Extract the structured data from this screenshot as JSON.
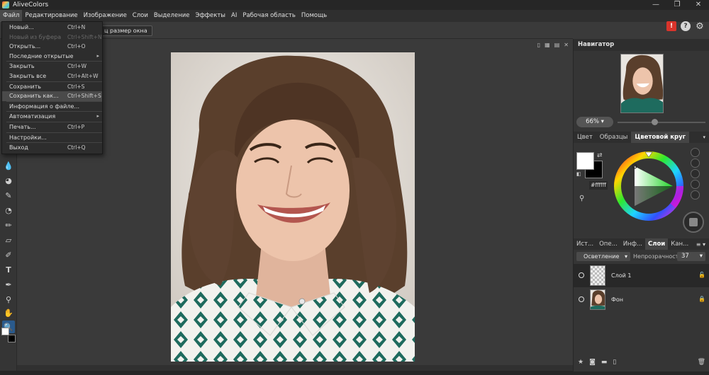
{
  "app": {
    "title": "AliveColors"
  },
  "window_controls": {
    "minimize": "—",
    "maximize": "❐",
    "close": "✕"
  },
  "menubar": [
    "Файл",
    "Редактирование",
    "Изображение",
    "Слои",
    "Выделение",
    "Эффекты",
    "AI",
    "Рабочая область",
    "Помощь"
  ],
  "options": {
    "fit_button": "ц размер окна"
  },
  "file_menu": [
    {
      "label": "Новый...",
      "shortcut": "Ctrl+N"
    },
    {
      "label": "Новый из буфера",
      "shortcut": "Ctrl+Shift+N",
      "disabled": true
    },
    {
      "label": "Открыть...",
      "shortcut": "Ctrl+O"
    },
    {
      "label": "Последние открытые",
      "shortcut": "",
      "submenu": true
    },
    {
      "sep": true
    },
    {
      "label": "Закрыть",
      "shortcut": "Ctrl+W"
    },
    {
      "label": "Закрыть все",
      "shortcut": "Ctrl+Alt+W"
    },
    {
      "sep": true
    },
    {
      "label": "Сохранить",
      "shortcut": "Ctrl+S"
    },
    {
      "label": "Сохранить как...",
      "shortcut": "Ctrl+Shift+S",
      "hover": true
    },
    {
      "sep": true
    },
    {
      "label": "Информация о файле...",
      "shortcut": ""
    },
    {
      "sep": true
    },
    {
      "label": "Автоматизация",
      "shortcut": "",
      "submenu": true
    },
    {
      "sep": true
    },
    {
      "label": "Печать...",
      "shortcut": "Ctrl+P"
    },
    {
      "sep": true
    },
    {
      "label": "Настройки...",
      "shortcut": ""
    },
    {
      "sep": true
    },
    {
      "label": "Выход",
      "shortcut": "Ctrl+Q"
    }
  ],
  "navigator": {
    "title": "Навигатор",
    "zoom": "66%",
    "zoom_slider_fraction": 0.42
  },
  "color_panel": {
    "tabs": [
      "Цвет",
      "Образцы",
      "Цветовой круг"
    ],
    "active_tab": "Цветовой круг",
    "hex": "#ffffff",
    "fg_color": "#ffffff",
    "bg_color": "#000000"
  },
  "layers_panel": {
    "tabs": [
      "Ист...",
      "Опе...",
      "Инф...",
      "Слои",
      "Кан..."
    ],
    "active_tab": "Слои",
    "blend_mode": "Осветление",
    "opacity_label": "Непрозрачность",
    "opacity": "37",
    "layers": [
      {
        "name": "Слой 1",
        "selected": true
      },
      {
        "name": "Фон",
        "selected": false
      }
    ]
  },
  "colors": {
    "accent": "#2a5a8c",
    "panel_bg": "#353535",
    "alert": "#d9342b"
  }
}
